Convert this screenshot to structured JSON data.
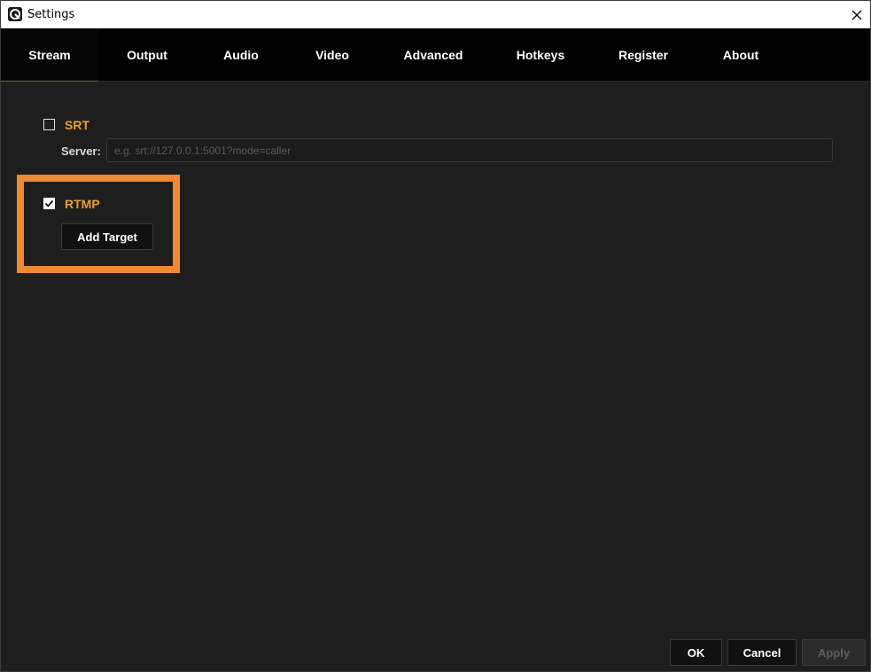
{
  "window": {
    "title": "Settings",
    "app_icon": "app-logo-icon",
    "close_icon": "close-icon"
  },
  "tabs": [
    {
      "label": "Stream",
      "active": true
    },
    {
      "label": "Output",
      "active": false
    },
    {
      "label": "Audio",
      "active": false
    },
    {
      "label": "Video",
      "active": false
    },
    {
      "label": "Advanced",
      "active": false
    },
    {
      "label": "Hotkeys",
      "active": false
    },
    {
      "label": "Register",
      "active": false
    },
    {
      "label": "About",
      "active": false
    }
  ],
  "stream": {
    "srt": {
      "label": "SRT",
      "checked": false,
      "server_label": "Server:",
      "server_value": "",
      "server_placeholder": "e.g. srt://127.0.0.1:5001?mode=caller"
    },
    "rtmp": {
      "label": "RTMP",
      "checked": true,
      "add_target_label": "Add Target"
    }
  },
  "footer": {
    "ok_label": "OK",
    "cancel_label": "Cancel",
    "apply_label": "Apply",
    "apply_disabled": true
  },
  "colors": {
    "accent_label": "#f0a023",
    "highlight_border": "#f08a2c",
    "background": "#1e1e1e",
    "tabbar": "#000000"
  }
}
